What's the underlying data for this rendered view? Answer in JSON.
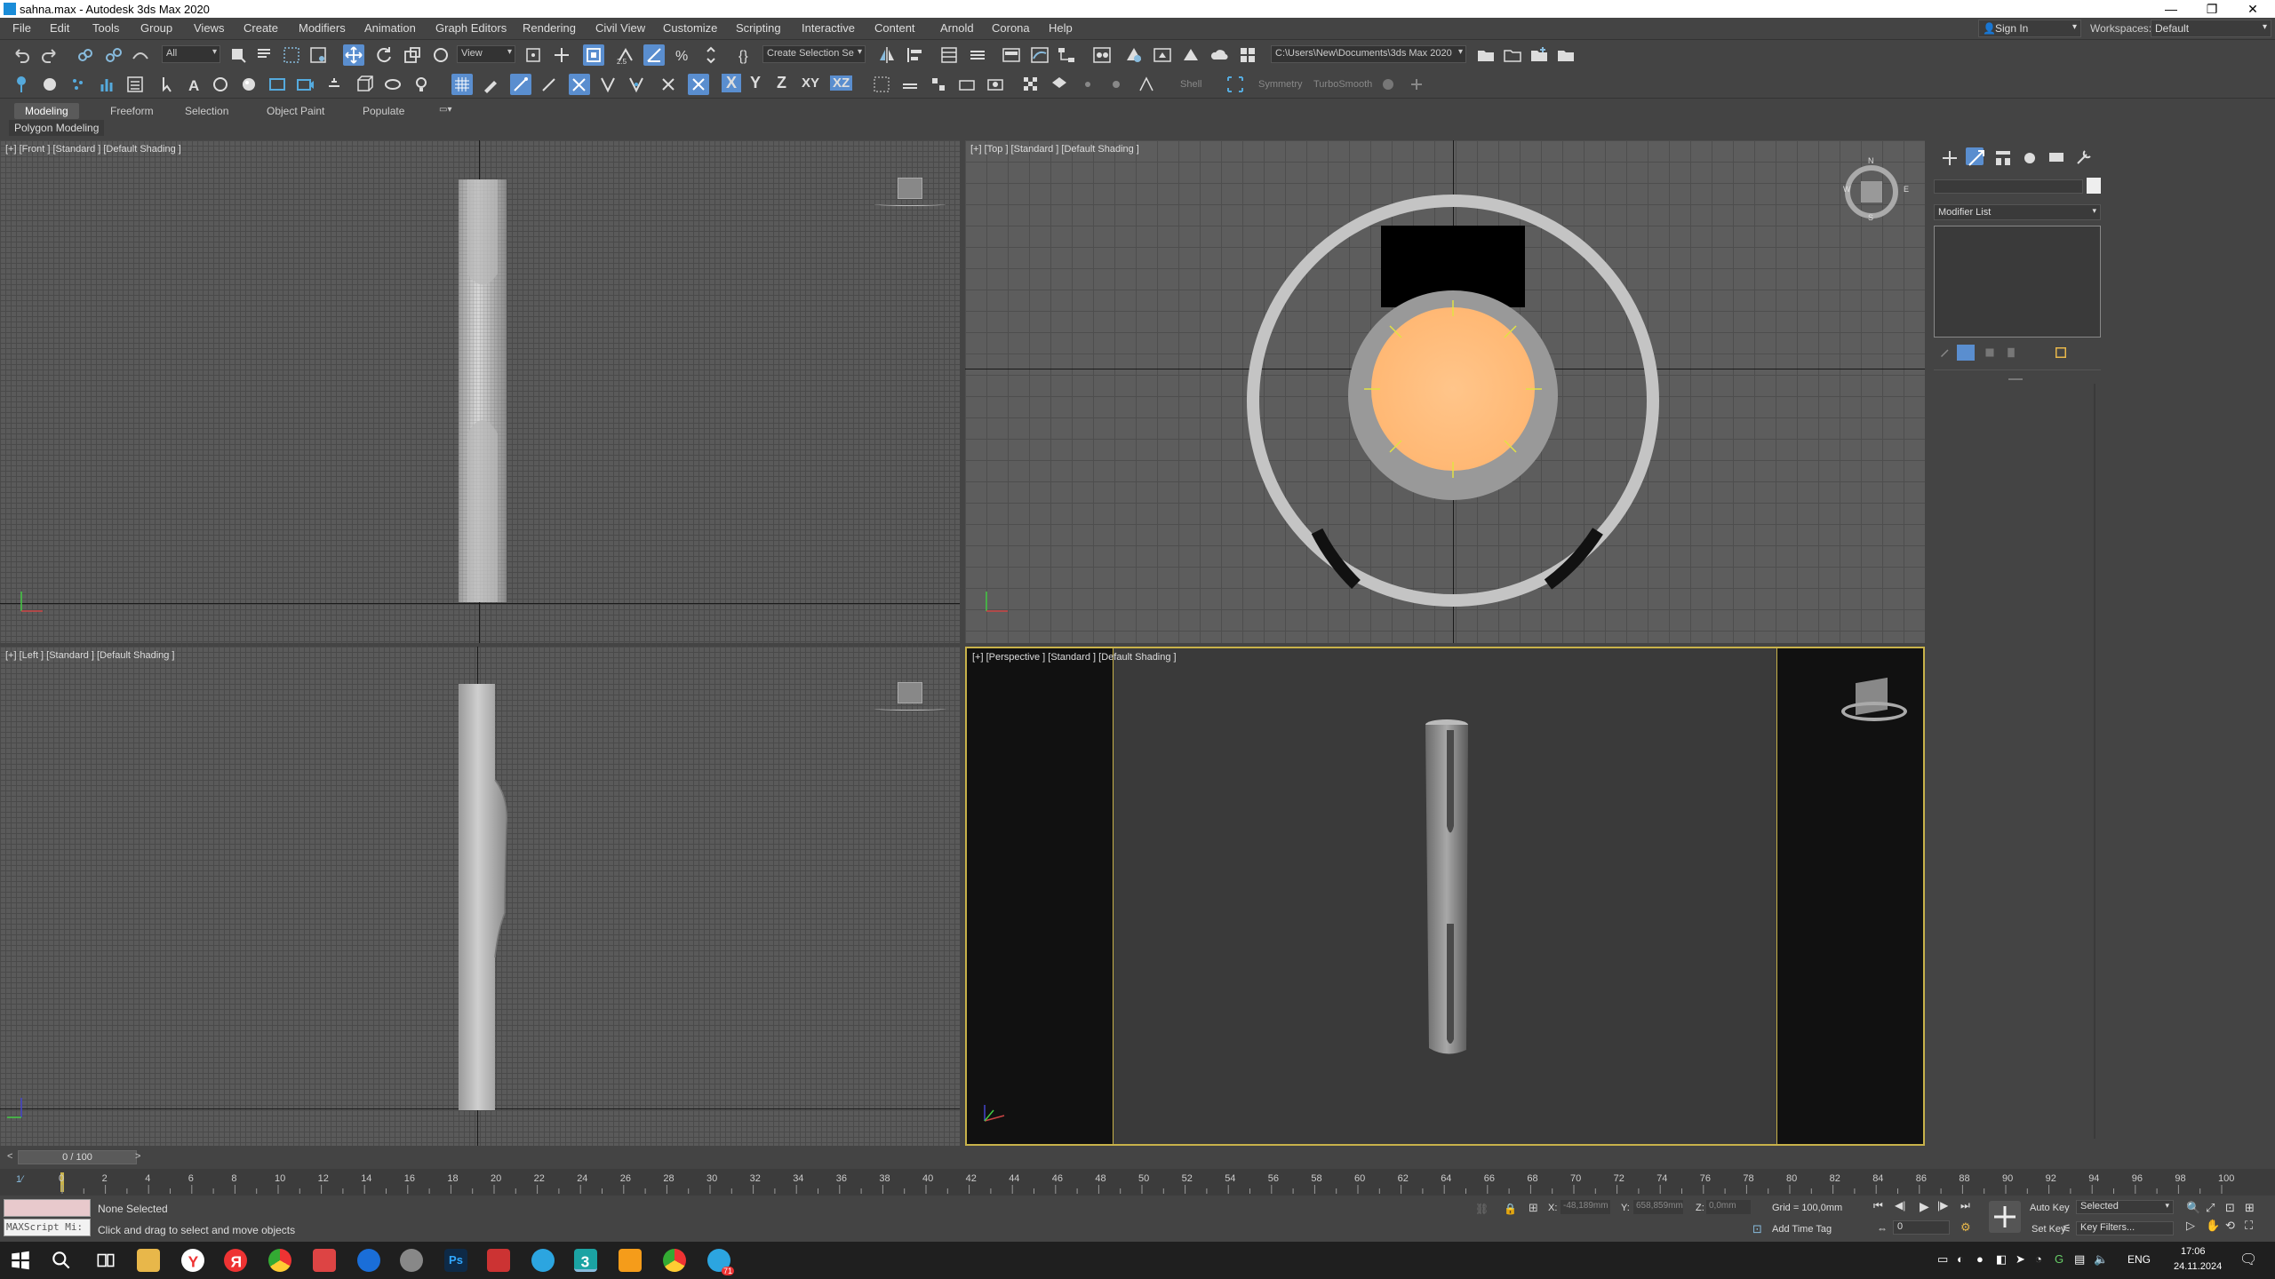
{
  "window": {
    "title": "sahna.max - Autodesk 3ds Max 2020"
  },
  "menu": [
    "File",
    "Edit",
    "Tools",
    "Group",
    "Views",
    "Create",
    "Modifiers",
    "Animation",
    "Graph Editors",
    "Rendering",
    "Civil View",
    "Customize",
    "Scripting",
    "Interactive",
    "Content",
    "Arnold",
    "Corona",
    "Help"
  ],
  "account": {
    "signin": "Sign In",
    "workspaces_label": "Workspaces:",
    "workspace": "Default"
  },
  "toolbar": {
    "selection_filter": "All",
    "ref_coord": "View",
    "named_selection": "Create Selection Se",
    "project_path": "C:\\Users\\New\\Documents\\3ds Max 2020",
    "axis_x": "X",
    "axis_y": "Y",
    "axis_z": "Z",
    "axis_xy": "XY",
    "axis_xz": "XZ",
    "shell": "Shell",
    "symmetry": "Symmetry",
    "turbosmooth": "TurboSmooth"
  },
  "ribbon": {
    "tabs": [
      "Modeling",
      "Freeform",
      "Selection",
      "Object Paint",
      "Populate"
    ],
    "panel": "Polygon Modeling"
  },
  "viewports": {
    "front": "[+] [Front ] [Standard ] [Default Shading ]",
    "top": "[+] [Top ] [Standard ] [Default Shading ]",
    "left": "[+] [Left ] [Standard ] [Default Shading ]",
    "perspective": "[+] [Perspective ] [Standard ] [Default Shading ]",
    "compass": {
      "n": "N",
      "s": "S",
      "e": "E",
      "w": "W"
    }
  },
  "command_panel": {
    "modifier_list": "Modifier List"
  },
  "time": {
    "frame": "0 / 100",
    "ticks": [
      "0",
      "2",
      "4",
      "6",
      "8",
      "10",
      "12",
      "14",
      "16",
      "18",
      "20",
      "22",
      "24",
      "26",
      "28",
      "30",
      "32",
      "34",
      "36",
      "38",
      "40",
      "42",
      "44",
      "46",
      "48",
      "50",
      "52",
      "54",
      "56",
      "58",
      "60",
      "62",
      "64",
      "66",
      "68",
      "70",
      "72",
      "74",
      "76",
      "78",
      "80",
      "82",
      "84",
      "86",
      "88",
      "90",
      "92",
      "94",
      "96",
      "98",
      "100"
    ]
  },
  "status": {
    "maxscript": "MAXScript Mi:",
    "selection": "None Selected",
    "prompt": "Click and drag to select and move objects",
    "x_label": "X:",
    "x_value": "-48,189mm",
    "y_label": "Y:",
    "y_value": "658,859mm",
    "z_label": "Z:",
    "z_value": "0,0mm",
    "grid": "Grid = 100,0mm",
    "add_time_tag": "Add Time Tag",
    "auto_key": "Auto Key",
    "set_key": "Set Key",
    "key_mode": "Selected",
    "key_filters": "Key Filters...",
    "frame_field": "0"
  },
  "taskbar": {
    "lang": "ENG",
    "time": "17:06",
    "date": "24.11.2024",
    "telegram_badge": "71"
  }
}
